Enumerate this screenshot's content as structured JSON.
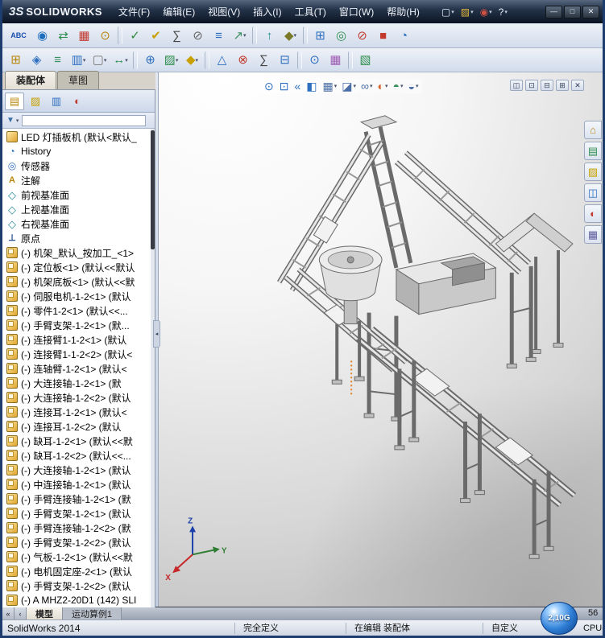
{
  "window": {
    "logo_mark": "3S",
    "logo_text": "SOLIDWORKS",
    "menus": [
      "文件(F)",
      "编辑(E)",
      "视图(V)",
      "插入(I)",
      "工具(T)",
      "窗口(W)",
      "帮助(H)"
    ],
    "quick_icons": [
      {
        "name": "new-document-icon",
        "glyph": "▢",
        "color": "#e8eef8",
        "arrow": "▾",
        "inter": "true"
      },
      {
        "name": "open-document-icon",
        "glyph": "▨",
        "color": "#e4b73c",
        "arrow": "▾",
        "inter": "true"
      },
      {
        "name": "recent-documents-icon",
        "glyph": "◉",
        "color": "#d05040",
        "arrow": "▾",
        "inter": "true"
      },
      {
        "name": "help-icon",
        "glyph": "?",
        "color": "#e8eef8",
        "arrow": "▾",
        "inter": "true"
      }
    ],
    "window_buttons": [
      {
        "name": "minimize-button",
        "glyph": "—",
        "inter": "true"
      },
      {
        "name": "maximize-button",
        "glyph": "□",
        "inter": "true"
      },
      {
        "name": "close-button",
        "glyph": "✕",
        "inter": "true"
      }
    ]
  },
  "toolbar_row1": [
    {
      "name": "spell-checker-icon",
      "glyph": "ABC",
      "color": "#1a4fae",
      "cls": "wide",
      "arrow": "",
      "inter": "true"
    },
    {
      "name": "design-binder-icon",
      "glyph": "◉",
      "color": "#1f6fbf",
      "arrow": "",
      "inter": "true"
    },
    {
      "name": "compare-documents-icon",
      "glyph": "⇄",
      "color": "#2f8f4f",
      "arrow": "",
      "inter": "true"
    },
    {
      "name": "check-entity-icon",
      "glyph": "▦",
      "color": "#c23a2e",
      "arrow": "",
      "inter": "true"
    },
    {
      "name": "costing-icon",
      "glyph": "⊙",
      "color": "#b8860b",
      "arrow": "",
      "inter": "true"
    },
    {
      "name": "separator",
      "cls": "sep",
      "glyph": "",
      "arrow": "",
      "inter": "false"
    },
    {
      "name": "measure-icon",
      "glyph": "✓",
      "color": "#2e8b3a",
      "arrow": "",
      "inter": "true"
    },
    {
      "name": "markup-icon",
      "glyph": "✔",
      "color": "#c8a000",
      "arrow": "",
      "inter": "true"
    },
    {
      "name": "equations-icon",
      "glyph": "∑",
      "color": "#444444",
      "arrow": "",
      "inter": "true"
    },
    {
      "name": "section-properties-icon",
      "glyph": "⊘",
      "color": "#666666",
      "arrow": "",
      "inter": "true"
    },
    {
      "name": "mass-properties-icon",
      "glyph": "≡",
      "color": "#2f6fbf",
      "arrow": "",
      "inter": "true"
    },
    {
      "name": "deviation-analysis-icon",
      "glyph": "↗",
      "color": "#3a8f5f",
      "arrow": "▾",
      "inter": "true"
    },
    {
      "name": "separator",
      "cls": "sep",
      "glyph": "",
      "arrow": "",
      "inter": "false"
    },
    {
      "name": "reload-icon",
      "glyph": "↑",
      "color": "#1f8f8f",
      "arrow": "",
      "inter": "true"
    },
    {
      "name": "curvature-icon",
      "glyph": "◆",
      "color": "#7a7a2a",
      "arrow": "▾",
      "inter": "true"
    },
    {
      "name": "separator",
      "cls": "sep",
      "glyph": "",
      "arrow": "",
      "inter": "false"
    },
    {
      "name": "design-table-icon",
      "glyph": "⊞",
      "color": "#2f6fbf",
      "arrow": "",
      "inter": "true"
    },
    {
      "name": "zebra-stripes-icon",
      "glyph": "◎",
      "color": "#2f8f4f",
      "arrow": "",
      "inter": "true"
    },
    {
      "name": "undercut-analysis-icon",
      "glyph": "⊘",
      "color": "#c23a2e",
      "arrow": "",
      "inter": "true"
    },
    {
      "name": "draft-analysis-icon",
      "glyph": "■",
      "color": "#c23a2e",
      "arrow": "",
      "inter": "true"
    },
    {
      "name": "symmetry-check-icon",
      "glyph": "◔",
      "color": "#2f6fbf",
      "arrow": "",
      "inter": "true"
    }
  ],
  "toolbar_row2": [
    {
      "name": "insert-components-icon",
      "glyph": "⊞",
      "color": "#b8860b",
      "arrow": "",
      "inter": "true"
    },
    {
      "name": "mate-icon",
      "glyph": "◈",
      "color": "#2f6fbf",
      "arrow": "",
      "inter": "true"
    },
    {
      "name": "smart-fasteners-icon",
      "glyph": "≡",
      "color": "#3a8f5f",
      "arrow": "",
      "inter": "true"
    },
    {
      "name": "component-pattern-icon",
      "glyph": "▥",
      "color": "#2f6fbf",
      "arrow": "▾",
      "inter": "true"
    },
    {
      "name": "new-part-icon",
      "glyph": "▢",
      "color": "#777777",
      "arrow": "▾",
      "inter": "true"
    },
    {
      "name": "move-component-icon",
      "glyph": "↔",
      "color": "#2f8f4f",
      "arrow": "▾",
      "inter": "true"
    },
    {
      "name": "separator",
      "cls": "sep",
      "glyph": "",
      "arrow": "",
      "inter": "false"
    },
    {
      "name": "assembly-features-icon",
      "glyph": "⊕",
      "color": "#2f6fbf",
      "arrow": "",
      "inter": "true"
    },
    {
      "name": "reference-geometry-icon",
      "glyph": "▨",
      "color": "#2f8f4f",
      "arrow": "▾",
      "inter": "true"
    },
    {
      "name": "sketch-icon",
      "glyph": "◆",
      "color": "#c8a000",
      "arrow": "▾",
      "inter": "true"
    },
    {
      "name": "separator",
      "cls": "sep",
      "glyph": "",
      "arrow": "",
      "inter": "false"
    },
    {
      "name": "exploded-view-icon",
      "glyph": "△",
      "color": "#2f6fbf",
      "arrow": "",
      "inter": "true"
    },
    {
      "name": "interference-detection-icon",
      "glyph": "⊗",
      "color": "#c23a2e",
      "arrow": "",
      "inter": "true"
    },
    {
      "name": "assembly-statistics-icon",
      "glyph": "∑",
      "color": "#444444",
      "arrow": "",
      "inter": "true"
    },
    {
      "name": "window-select-icon",
      "glyph": "⊟",
      "color": "#2f6fbf",
      "arrow": "",
      "inter": "true"
    },
    {
      "name": "separator",
      "cls": "sep",
      "glyph": "",
      "arrow": "",
      "inter": "false"
    },
    {
      "name": "magnifier-icon",
      "glyph": "⊙",
      "color": "#2f6fbf",
      "arrow": "",
      "inter": "true"
    },
    {
      "name": "appearances-grid-icon",
      "glyph": "▦",
      "color": "#a05fb5",
      "arrow": "",
      "inter": "true"
    },
    {
      "name": "separator",
      "cls": "sep",
      "glyph": "",
      "arrow": "",
      "inter": "false"
    },
    {
      "name": "grid-system-icon",
      "glyph": "▧",
      "color": "#2f8f4f",
      "arrow": "",
      "inter": "true"
    }
  ],
  "command_tabs": [
    {
      "label": "装配体",
      "cls": "active",
      "name": "tab-assembly",
      "inter": "true"
    },
    {
      "label": "草图",
      "cls": "",
      "name": "tab-sketch",
      "inter": "true"
    }
  ],
  "feature_panel": {
    "pane_tabs": [
      {
        "name": "featuremanager-tab-icon",
        "glyph": "▤",
        "color": "#b8860b",
        "cls": "active",
        "inter": "true"
      },
      {
        "name": "propertymanager-tab-icon",
        "glyph": "▨",
        "color": "#c8a000",
        "cls": "",
        "inter": "true"
      },
      {
        "name": "configurationmanager-tab-icon",
        "glyph": "▥",
        "color": "#2f6fbf",
        "cls": "",
        "inter": "true"
      },
      {
        "name": "displaymanager-tab-icon",
        "glyph": "◐",
        "color": "#c23a2e",
        "cls": "",
        "inter": "true"
      }
    ],
    "overflow_glyph": "»",
    "filter_glyph": "▼",
    "filter_arrow": "▾",
    "tree": [
      {
        "cls": "i-assembly",
        "icon": "assembly-icon",
        "label": "LED 灯插板机 (默认<默认_"
      },
      {
        "cls": "i-history",
        "icon": "history-folder-icon",
        "label": "History"
      },
      {
        "cls": "i-sensors",
        "icon": "sensors-folder-icon",
        "label": "传感器"
      },
      {
        "cls": "i-annotations",
        "icon": "annotations-folder-icon",
        "label": "注解"
      },
      {
        "cls": "i-plane",
        "icon": "plane-icon",
        "label": "前视基准面"
      },
      {
        "cls": "i-plane",
        "icon": "plane-icon",
        "label": "上视基准面"
      },
      {
        "cls": "i-plane",
        "icon": "plane-icon",
        "label": "右视基准面"
      },
      {
        "cls": "i-origin",
        "icon": "origin-icon",
        "label": "原点"
      },
      {
        "cls": "i-component",
        "icon": "component-icon",
        "label": "(-) 机架_默认_按加工_<1>"
      },
      {
        "cls": "i-component",
        "icon": "component-icon",
        "label": "(-) 定位板<1> (默认<<默认"
      },
      {
        "cls": "i-component",
        "icon": "component-icon",
        "label": "(-) 机架底板<1> (默认<<默"
      },
      {
        "cls": "i-component",
        "icon": "component-icon",
        "label": "(-) 伺服电机-1-2<1> (默认"
      },
      {
        "cls": "i-component",
        "icon": "component-icon",
        "label": "(-) 零件1-2<1> (默认<<..."
      },
      {
        "cls": "i-component",
        "icon": "component-icon",
        "label": "(-) 手臂支架-1-2<1> (默..."
      },
      {
        "cls": "i-component",
        "icon": "component-icon",
        "label": "(-) 连接臂1-1-2<1> (默认"
      },
      {
        "cls": "i-component",
        "icon": "component-icon",
        "label": "(-) 连接臂1-1-2<2> (默认<"
      },
      {
        "cls": "i-component",
        "icon": "component-icon",
        "label": "(-) 连轴臂-1-2<1> (默认<"
      },
      {
        "cls": "i-component",
        "icon": "component-icon",
        "label": "(-) 大连接轴-1-2<1> (默"
      },
      {
        "cls": "i-component",
        "icon": "component-icon",
        "label": "(-) 大连接轴-1-2<2> (默认"
      },
      {
        "cls": "i-component",
        "icon": "component-icon",
        "label": "(-) 连接耳-1-2<1> (默认<"
      },
      {
        "cls": "i-component",
        "icon": "component-icon",
        "label": "(-) 连接耳-1-2<2> (默认"
      },
      {
        "cls": "i-component",
        "icon": "component-icon",
        "label": "(-) 缺耳-1-2<1> (默认<<默"
      },
      {
        "cls": "i-component",
        "icon": "component-icon",
        "label": "(-) 缺耳-1-2<2> (默认<<..."
      },
      {
        "cls": "i-component",
        "icon": "component-icon",
        "label": "(-) 大连接轴-1-2<1> (默认"
      },
      {
        "cls": "i-component",
        "icon": "component-icon",
        "label": "(-) 中连接轴-1-2<1> (默认"
      },
      {
        "cls": "i-component",
        "icon": "component-icon",
        "label": "(-) 手臂连接轴-1-2<1> (默"
      },
      {
        "cls": "i-component",
        "icon": "component-icon",
        "label": "(-) 手臂支架-1-2<1> (默认"
      },
      {
        "cls": "i-component",
        "icon": "component-icon",
        "label": "(-) 手臂连接轴-1-2<2> (默"
      },
      {
        "cls": "i-component",
        "icon": "component-icon",
        "label": "(-) 手臂支架-1-2<2> (默认"
      },
      {
        "cls": "i-component",
        "icon": "component-icon",
        "label": "(-) 气板-1-2<1> (默认<<默"
      },
      {
        "cls": "i-component",
        "icon": "component-icon",
        "label": "(-) 电机固定座-2<1> (默认"
      },
      {
        "cls": "i-component",
        "icon": "component-icon",
        "label": "(-) 手臂支架-1-2<2> (默认"
      },
      {
        "cls": "i-component",
        "icon": "component-icon",
        "label": "(-) A MHZ2-20D1 (142) SLI"
      }
    ]
  },
  "viewport": {
    "view_toolbar": [
      {
        "name": "zoom-fit-icon",
        "glyph": "⊙",
        "color": "#2f6fbf",
        "arrow": "",
        "inter": "true"
      },
      {
        "name": "zoom-area-icon",
        "glyph": "⊡",
        "color": "#2f6fbf",
        "arrow": "",
        "inter": "true"
      },
      {
        "name": "previous-view-icon",
        "glyph": "«",
        "color": "#2f6fbf",
        "arrow": "",
        "inter": "true"
      },
      {
        "name": "section-view-icon",
        "glyph": "◧",
        "color": "#2f6fbf",
        "arrow": "",
        "inter": "true"
      },
      {
        "name": "view-orientation-icon",
        "glyph": "▦",
        "color": "#4a6ea5",
        "arrow": "▾",
        "inter": "true"
      },
      {
        "name": "display-style-icon",
        "glyph": "◪",
        "color": "#4a6ea5",
        "arrow": "▾",
        "inter": "true"
      },
      {
        "name": "hide-show-items-icon",
        "glyph": "∞",
        "color": "#4a6ea5",
        "arrow": "▾",
        "inter": "true"
      },
      {
        "name": "edit-appearance-icon",
        "glyph": "◐",
        "color": "#d4652f",
        "arrow": "▾",
        "inter": "true"
      },
      {
        "name": "apply-scene-icon",
        "glyph": "◓",
        "color": "#3a8f5f",
        "arrow": "▾",
        "inter": "true"
      },
      {
        "name": "view-settings-icon",
        "glyph": "◒",
        "color": "#4a6ea5",
        "arrow": "▾",
        "inter": "true"
      }
    ],
    "window_controls": [
      {
        "name": "cascade-windows-icon",
        "glyph": "◫",
        "inter": "true"
      },
      {
        "name": "restore-window-icon",
        "glyph": "⊡",
        "inter": "true"
      },
      {
        "name": "minimize-window-icon",
        "glyph": "⊟",
        "inter": "true"
      },
      {
        "name": "maximize-window-icon",
        "glyph": "⊞",
        "inter": "true"
      },
      {
        "name": "close-window-icon",
        "glyph": "✕",
        "inter": "true"
      }
    ],
    "task_pane_tabs": [
      {
        "name": "resources-home-icon",
        "glyph": "⌂",
        "color": "#b8860b",
        "inter": "true"
      },
      {
        "name": "design-library-icon",
        "glyph": "▤",
        "color": "#2f8f4f",
        "inter": "true"
      },
      {
        "name": "file-explorer-icon",
        "glyph": "▨",
        "color": "#c8a000",
        "inter": "true"
      },
      {
        "name": "view-palette-icon",
        "glyph": "◫",
        "color": "#2f6fbf",
        "inter": "true"
      },
      {
        "name": "appearances-scenes-icon",
        "glyph": "◐",
        "color": "#c23a2e",
        "inter": "true"
      },
      {
        "name": "custom-properties-icon",
        "glyph": "▦",
        "color": "#5f5f9f",
        "inter": "true"
      }
    ],
    "triad": {
      "x": "X",
      "y": "Y",
      "z": "Z"
    }
  },
  "bottom_tabs": {
    "nav": [
      {
        "name": "tab-scroll-first-icon",
        "glyph": "«",
        "inter": "true"
      },
      {
        "name": "tab-scroll-prev-icon",
        "glyph": "‹",
        "inter": "true"
      }
    ],
    "tabs": [
      {
        "label": "模型",
        "cls": "active",
        "name": "tab-model",
        "inter": "true"
      },
      {
        "label": "运动算例1",
        "cls": "",
        "name": "tab-motion-study-1",
        "inter": "true"
      }
    ]
  },
  "status_bar": {
    "app": "SolidWorks 2014",
    "define_state": "完全定义",
    "edit_state": "在编辑 装配体",
    "custom": "自定义",
    "memory": "2,10G",
    "corner_top": "56",
    "corner_bottom": "CPU-"
  }
}
